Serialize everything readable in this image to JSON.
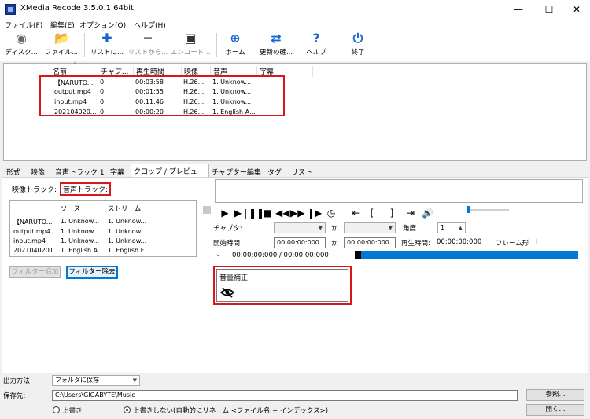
{
  "window": {
    "title": "XMedia Recode 3.5.0.1 64bit",
    "minimize": "—",
    "maximize": "☐",
    "close": "✕"
  },
  "menu": [
    "ファイル(F)",
    "編集(E)",
    "オプション(O)",
    "ヘルプ(H)"
  ],
  "toolbar": [
    {
      "label": "ディスク...",
      "icon": "disc-icon",
      "glyph": "◉",
      "color": "#6a6a6a"
    },
    {
      "label": "ファイル...",
      "icon": "folder-icon",
      "glyph": "📂",
      "color": "#e0a82e"
    },
    {
      "label": "リストに...",
      "icon": "plus-icon",
      "glyph": "✚",
      "color": "#1464d2"
    },
    {
      "label": "リストから...",
      "icon": "minus-icon",
      "glyph": "━",
      "color": "#777777"
    },
    {
      "label": "エンコード...",
      "icon": "encode-icon",
      "glyph": "▣",
      "color": "#333333"
    },
    {
      "label": "ホーム",
      "icon": "globe-icon",
      "glyph": "⊕",
      "color": "#1464d2"
    },
    {
      "label": "更新の確...",
      "icon": "refresh-icon",
      "glyph": "⇄",
      "color": "#1464d2"
    },
    {
      "label": "ヘルプ",
      "icon": "help-icon",
      "glyph": "?",
      "color": "#1464d2"
    },
    {
      "label": "終了",
      "icon": "power-icon",
      "glyph": "⏻",
      "color": "#1464d2"
    }
  ],
  "file_list": {
    "sort_indicator": "^",
    "columns": [
      "名前",
      "チャプ...",
      "再生時間",
      "映像",
      "音声",
      "字幕"
    ],
    "rows": [
      [
        "【NARUTO...",
        "0",
        "00:03:58",
        "H.26...",
        "1. Unknow...",
        ""
      ],
      [
        "output.mp4",
        "0",
        "00:01:55",
        "H.26...",
        "1. Unknow...",
        ""
      ],
      [
        "input.mp4",
        "0",
        "00:11:46",
        "H.26...",
        "1. Unknow...",
        ""
      ],
      [
        "202104020...",
        "0",
        "00:00:20",
        "H.26...",
        "1. English A...",
        ""
      ]
    ]
  },
  "tabs": [
    "形式",
    "映像",
    "音声トラック 1",
    "字幕",
    "クロップ / プレビュー",
    "チャプター編集",
    "タグ",
    "リスト"
  ],
  "active_tab": "クロップ / プレビュー",
  "sub_tabs": {
    "video": "映像トラック:",
    "audio": "音声トラック:"
  },
  "stream_table": {
    "columns": [
      "ソース",
      "ストリーム"
    ],
    "rows": [
      [
        "【NARUTO...",
        "1. Unknow...",
        "1. Unknow..."
      ],
      [
        "output.mp4",
        "1. Unknow...",
        "1. Unknow..."
      ],
      [
        "input.mp4",
        "1. Unknow...",
        "1. Unknow..."
      ],
      [
        "2021040201...",
        "1. English A...",
        "1. English F..."
      ]
    ]
  },
  "buttons": {
    "add_filter": "フィルター追加",
    "remove_filter": "フィルター除去"
  },
  "preview": {
    "chapter_label": "チャプタ:",
    "to_label_1": "か",
    "angle_label": "角度",
    "angle_value": "1",
    "start_time_label": "開始時間",
    "start_time_value": "00:00:00:000",
    "to_label_2": "か",
    "end_time_value": "00:00:00:000",
    "playtime_label": "再生時間:",
    "playtime_value": "00:00:00:000",
    "frame_label": "フレーム形",
    "frame_value": "I",
    "position_text": "00:00:00:000 / 00:00:00:000",
    "progress_fraction": 0.0
  },
  "filter": {
    "name": "音量補正",
    "icon": "eye-hidden-icon"
  },
  "bottom": {
    "output_label": "出力方法:",
    "output_value": "フォルダに保存",
    "save_label": "保存先:",
    "save_path": "C:\\Users\\GIGABYTE\\Music",
    "browse_button": "参照...",
    "open_button": "開く...",
    "overwrite_label": "上書き",
    "no_overwrite_label": "上書きしない(自動的にリネーム <ファイル名 + インデックス>)"
  }
}
